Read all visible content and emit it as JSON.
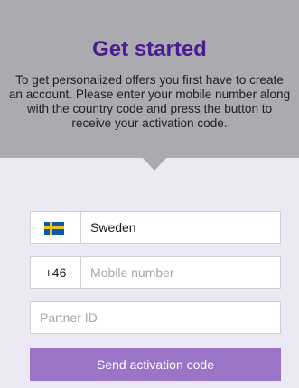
{
  "header": {
    "title": "Get started",
    "description": "To get personalized offers you first have to create an account. Please enter your mobile number along with the country code and press the button to receive your activation code."
  },
  "form": {
    "country": {
      "flag_icon": "sweden-flag-icon",
      "label": "Sweden"
    },
    "mobile": {
      "country_code": "+46",
      "placeholder": "Mobile number"
    },
    "partner": {
      "placeholder": "Partner ID"
    },
    "send_button_label": "Send activation code"
  },
  "colors": {
    "header_bg": "#ababaf",
    "title": "#4b1b93",
    "page_bg": "#ece9f4",
    "button_bg": "#9a74c7",
    "flag_blue": "#0a5aa6",
    "flag_yellow": "#f0c419"
  }
}
